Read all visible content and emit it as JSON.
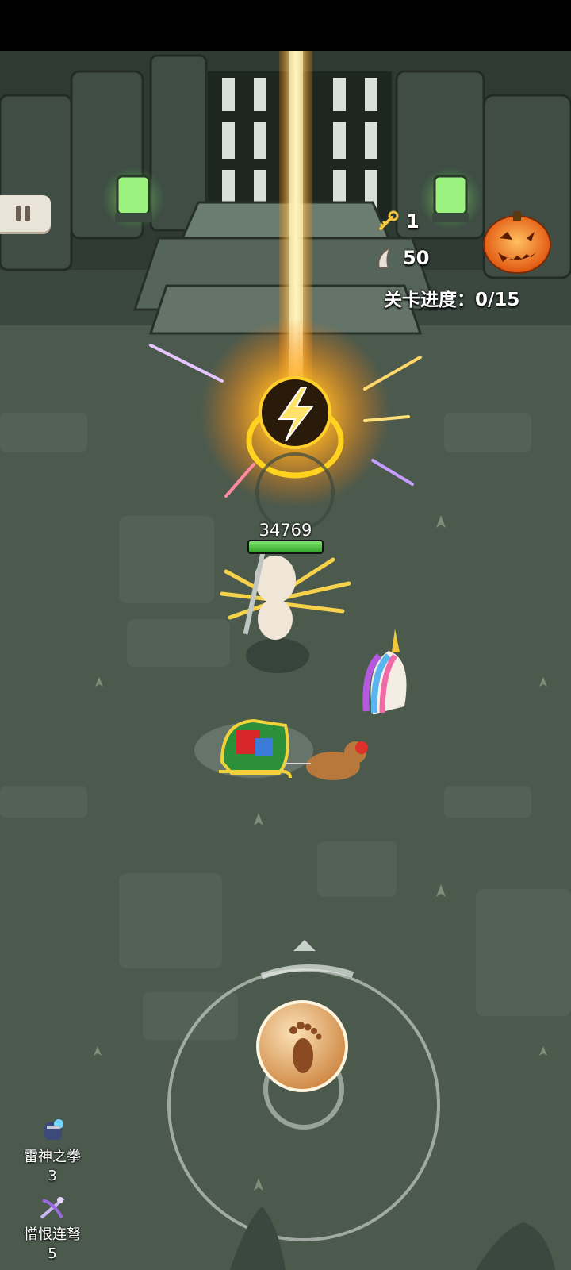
{
  "hud": {
    "keys_count": "1",
    "claws_count": "50",
    "stage_progress": "关卡进度：0/15"
  },
  "boss": {
    "hp_value": "34769",
    "hp_fraction": 1.0
  },
  "skills": [
    {
      "name": "雷神之拳",
      "level": "3",
      "icon": "thunder-fist-icon"
    },
    {
      "name": "憎恨连弩",
      "level": "5",
      "icon": "crossbow-icon"
    }
  ],
  "icons": {
    "pause": "pause-icon",
    "key": "key-icon",
    "claw": "claw-icon",
    "lightning": "lightning-icon",
    "pumpkin": "pumpkin-icon",
    "joystick": "footprint-icon"
  },
  "colors": {
    "ground": "#4b5a4d",
    "beam": "#ffb020",
    "hp_green": "#4fc441"
  }
}
